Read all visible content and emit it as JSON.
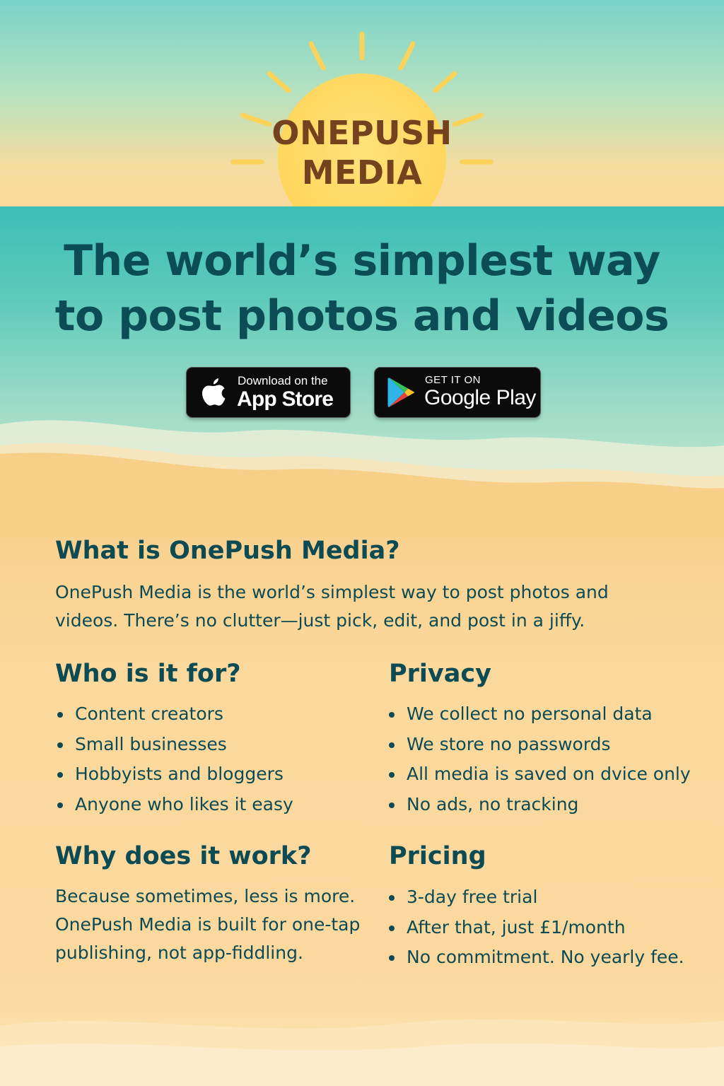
{
  "brand": {
    "logo_line1": "ONEPUSH",
    "logo_line2": "MEDIA"
  },
  "hero": {
    "headline": "The world’s simplest way to post photos and videos"
  },
  "store_buttons": {
    "apple": {
      "small": "Download on the",
      "big": "App Store",
      "icon": "apple-icon"
    },
    "google": {
      "small": "GET IT ON",
      "big": "Google Play",
      "icon": "google-play-icon"
    }
  },
  "sections": {
    "what": {
      "heading": "What is OnePush Media?",
      "body": "OnePush Media is the world’s simplest way to post photos and videos. There’s no clutter—just pick, edit, and post in a jiffy."
    },
    "who": {
      "heading": "Who is it for?",
      "items": [
        "Content creators",
        "Small businesses",
        "Hobbyists and bloggers",
        "Anyone who likes it easy"
      ]
    },
    "privacy": {
      "heading": "Privacy",
      "items": [
        "We collect no personal data",
        "We store no passwords",
        "All media is saved on dvice only",
        "No ads, no tracking"
      ]
    },
    "why": {
      "heading": "Why does it work?",
      "body": "Because sometimes, less is more. OnePush Media is built for one-tap publishing, not app-fiddling."
    },
    "pricing": {
      "heading": "Pricing",
      "items": [
        "3-day free trial",
        "After that, just £1/month",
        "No commitment. No yearly fee."
      ]
    }
  },
  "colors": {
    "heading": "#0c4a54",
    "logo": "#74421f",
    "sun": "#ffd65c",
    "sea": "#3dbfb5",
    "sand": "#fbd89c"
  }
}
